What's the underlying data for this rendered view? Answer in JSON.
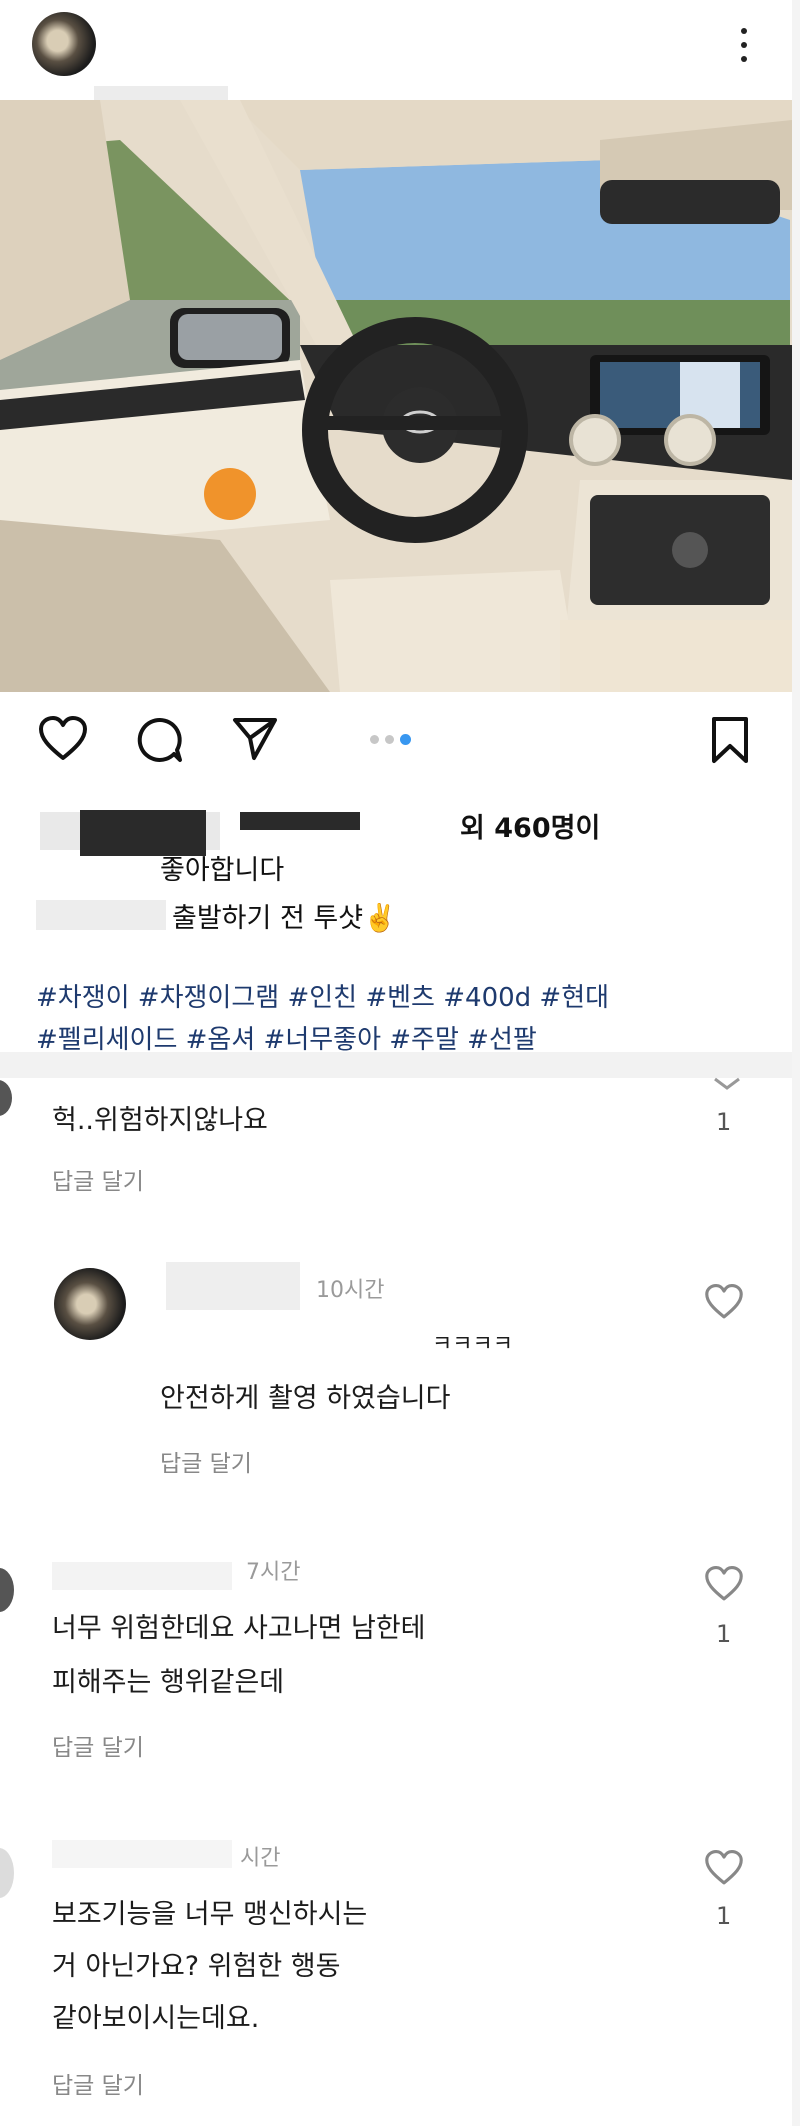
{
  "post": {
    "likes_suffix": "외 460명이",
    "likes_line2": "좋아합니다",
    "caption": "출발하기 전 투샷✌️",
    "hashtags_line1": "#차쟁이 #차쟁이그램 #인친 #벤츠 #400d #현대",
    "hashtags_line2": "#펠리세이드 #옴셔 #너무좋아 #주말 #선팔",
    "carousel_pages": 3,
    "carousel_active_index": 2
  },
  "icons": {
    "more": "more-vertical-icon",
    "like": "heart-icon",
    "comment": "comment-icon",
    "share": "send-icon",
    "save": "bookmark-icon"
  },
  "comments": [
    {
      "text": "헉..위험하지않나요",
      "reply": "답글 달기",
      "likes": "1"
    },
    {
      "time": "10시간",
      "prefix": "ㅋㅋㅋㅋ",
      "text": "안전하게 촬영 하였습니다",
      "reply": "답글 달기"
    },
    {
      "time": "7시간",
      "text_line1": "너무 위험한데요 사고나면 남한테",
      "text_line2": "피해주는 행위같은데",
      "reply": "답글 달기",
      "likes": "1"
    },
    {
      "time": "시간",
      "text_line1": "보조기능을 너무 맹신하시는",
      "text_line2": "거 아닌가요? 위험한 행동",
      "text_line3": "같아보이시는데요.",
      "reply": "답글 달기",
      "likes": "1"
    }
  ],
  "colors": {
    "hashtag": "#1e3a6e",
    "active_dot": "#3897f0"
  }
}
